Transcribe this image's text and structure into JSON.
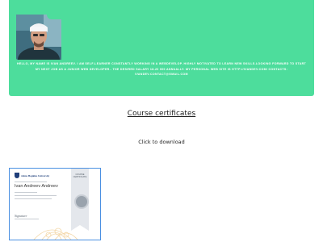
{
  "hero": {
    "bio": "Hello, my name is Ivan Andreev. I am self-learner constantly working in a webdevelop. Highly motivated to learn new skills.Looking forward to start my next job as a junior web developer.. The desired salary 18-20 000 annually. My personal web site is http://ivandev.com/ Contacts: ivandev.contact@gmail.com"
  },
  "certificates": {
    "title": "Course certificates",
    "click_label": "Click to download",
    "items": [
      {
        "university": "Johns Hopkins University",
        "recipient": "Ivan Andreev Andreev",
        "badge_text": "Course Certificate",
        "signature": "Signature"
      }
    ]
  },
  "colors": {
    "hero_bg": "#4ddd9c",
    "cert_border": "#4a90e2",
    "link_text": "#222222"
  }
}
